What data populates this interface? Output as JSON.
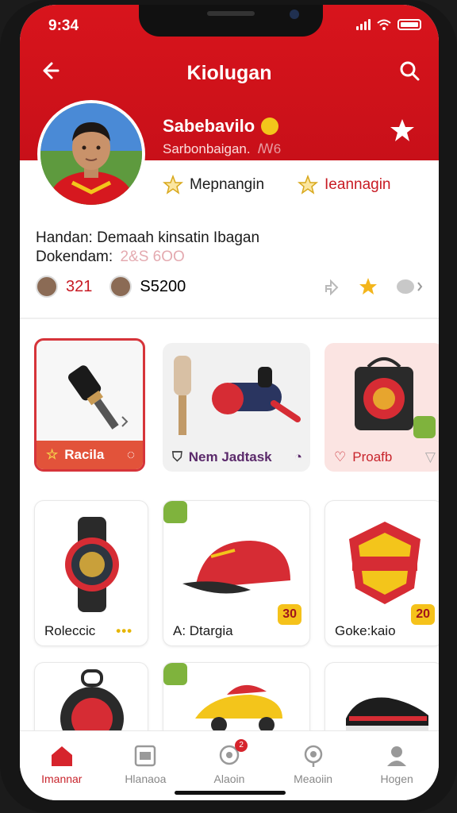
{
  "status": {
    "time": "9:34"
  },
  "header": {
    "title": "Kiolugan"
  },
  "profile": {
    "name": "Sabebavilo",
    "subtitle": "Sarbonbaigan.",
    "subtitle_suffix": "ꟿ6",
    "follow_label": "Mepnangin",
    "message_label": "Ieannagin"
  },
  "info": {
    "line1": "Handan: Demaah kinsatin Ibagan",
    "line2_label": "Dokendam:",
    "line2_value": "2&S 6OO"
  },
  "stats": {
    "value1": "321",
    "value2": "S5200"
  },
  "products": [
    {
      "label": "Racila"
    },
    {
      "label": "Nem Jadtask"
    },
    {
      "label": "Proafb"
    },
    {
      "label": "Roleccic",
      "extra": "•••"
    },
    {
      "label": "A: Dtargia",
      "price": "30"
    },
    {
      "label": "Goke:kaio",
      "price": "20"
    }
  ],
  "nav": {
    "items": [
      {
        "label": "Imannar"
      },
      {
        "label": "Hlanaoa"
      },
      {
        "label": "Alaoin",
        "badge": "2"
      },
      {
        "label": "Meaoiin"
      },
      {
        "label": "Hogen"
      }
    ]
  },
  "colors": {
    "brand_red": "#d8141c",
    "accent_yellow": "#f5c21b"
  }
}
